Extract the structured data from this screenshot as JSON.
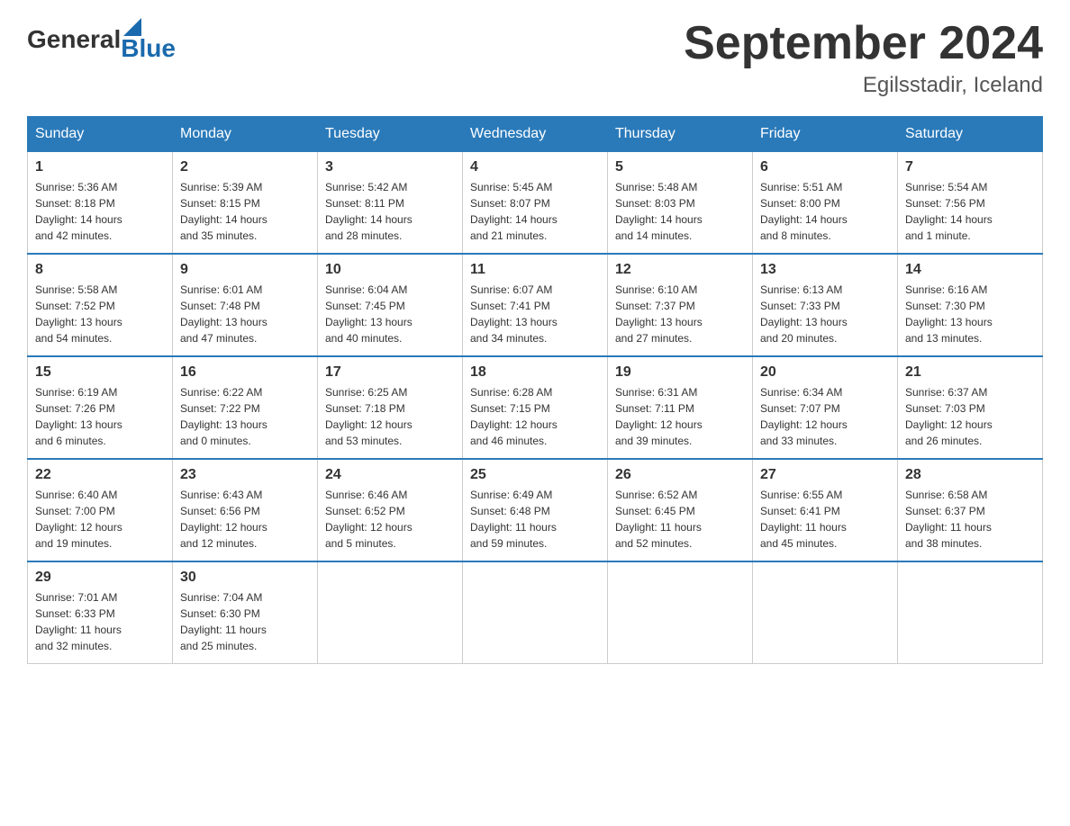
{
  "logo": {
    "general": "General",
    "blue": "Blue"
  },
  "title": "September 2024",
  "subtitle": "Egilsstadir, Iceland",
  "days_of_week": [
    "Sunday",
    "Monday",
    "Tuesday",
    "Wednesday",
    "Thursday",
    "Friday",
    "Saturday"
  ],
  "weeks": [
    [
      {
        "day": "1",
        "sunrise": "5:36 AM",
        "sunset": "8:18 PM",
        "daylight": "14 hours and 42 minutes."
      },
      {
        "day": "2",
        "sunrise": "5:39 AM",
        "sunset": "8:15 PM",
        "daylight": "14 hours and 35 minutes."
      },
      {
        "day": "3",
        "sunrise": "5:42 AM",
        "sunset": "8:11 PM",
        "daylight": "14 hours and 28 minutes."
      },
      {
        "day": "4",
        "sunrise": "5:45 AM",
        "sunset": "8:07 PM",
        "daylight": "14 hours and 21 minutes."
      },
      {
        "day": "5",
        "sunrise": "5:48 AM",
        "sunset": "8:03 PM",
        "daylight": "14 hours and 14 minutes."
      },
      {
        "day": "6",
        "sunrise": "5:51 AM",
        "sunset": "8:00 PM",
        "daylight": "14 hours and 8 minutes."
      },
      {
        "day": "7",
        "sunrise": "5:54 AM",
        "sunset": "7:56 PM",
        "daylight": "14 hours and 1 minute."
      }
    ],
    [
      {
        "day": "8",
        "sunrise": "5:58 AM",
        "sunset": "7:52 PM",
        "daylight": "13 hours and 54 minutes."
      },
      {
        "day": "9",
        "sunrise": "6:01 AM",
        "sunset": "7:48 PM",
        "daylight": "13 hours and 47 minutes."
      },
      {
        "day": "10",
        "sunrise": "6:04 AM",
        "sunset": "7:45 PM",
        "daylight": "13 hours and 40 minutes."
      },
      {
        "day": "11",
        "sunrise": "6:07 AM",
        "sunset": "7:41 PM",
        "daylight": "13 hours and 34 minutes."
      },
      {
        "day": "12",
        "sunrise": "6:10 AM",
        "sunset": "7:37 PM",
        "daylight": "13 hours and 27 minutes."
      },
      {
        "day": "13",
        "sunrise": "6:13 AM",
        "sunset": "7:33 PM",
        "daylight": "13 hours and 20 minutes."
      },
      {
        "day": "14",
        "sunrise": "6:16 AM",
        "sunset": "7:30 PM",
        "daylight": "13 hours and 13 minutes."
      }
    ],
    [
      {
        "day": "15",
        "sunrise": "6:19 AM",
        "sunset": "7:26 PM",
        "daylight": "13 hours and 6 minutes."
      },
      {
        "day": "16",
        "sunrise": "6:22 AM",
        "sunset": "7:22 PM",
        "daylight": "13 hours and 0 minutes."
      },
      {
        "day": "17",
        "sunrise": "6:25 AM",
        "sunset": "7:18 PM",
        "daylight": "12 hours and 53 minutes."
      },
      {
        "day": "18",
        "sunrise": "6:28 AM",
        "sunset": "7:15 PM",
        "daylight": "12 hours and 46 minutes."
      },
      {
        "day": "19",
        "sunrise": "6:31 AM",
        "sunset": "7:11 PM",
        "daylight": "12 hours and 39 minutes."
      },
      {
        "day": "20",
        "sunrise": "6:34 AM",
        "sunset": "7:07 PM",
        "daylight": "12 hours and 33 minutes."
      },
      {
        "day": "21",
        "sunrise": "6:37 AM",
        "sunset": "7:03 PM",
        "daylight": "12 hours and 26 minutes."
      }
    ],
    [
      {
        "day": "22",
        "sunrise": "6:40 AM",
        "sunset": "7:00 PM",
        "daylight": "12 hours and 19 minutes."
      },
      {
        "day": "23",
        "sunrise": "6:43 AM",
        "sunset": "6:56 PM",
        "daylight": "12 hours and 12 minutes."
      },
      {
        "day": "24",
        "sunrise": "6:46 AM",
        "sunset": "6:52 PM",
        "daylight": "12 hours and 5 minutes."
      },
      {
        "day": "25",
        "sunrise": "6:49 AM",
        "sunset": "6:48 PM",
        "daylight": "11 hours and 59 minutes."
      },
      {
        "day": "26",
        "sunrise": "6:52 AM",
        "sunset": "6:45 PM",
        "daylight": "11 hours and 52 minutes."
      },
      {
        "day": "27",
        "sunrise": "6:55 AM",
        "sunset": "6:41 PM",
        "daylight": "11 hours and 45 minutes."
      },
      {
        "day": "28",
        "sunrise": "6:58 AM",
        "sunset": "6:37 PM",
        "daylight": "11 hours and 38 minutes."
      }
    ],
    [
      {
        "day": "29",
        "sunrise": "7:01 AM",
        "sunset": "6:33 PM",
        "daylight": "11 hours and 32 minutes."
      },
      {
        "day": "30",
        "sunrise": "7:04 AM",
        "sunset": "6:30 PM",
        "daylight": "11 hours and 25 minutes."
      },
      null,
      null,
      null,
      null,
      null
    ]
  ],
  "labels": {
    "sunrise": "Sunrise:",
    "sunset": "Sunset:",
    "daylight": "Daylight:"
  }
}
